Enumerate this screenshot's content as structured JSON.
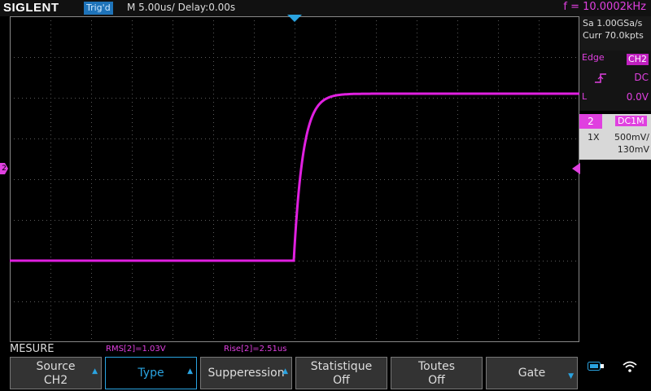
{
  "header": {
    "brand": "SIGLENT",
    "trigger_status": "Trig'd",
    "timebase": "M 5.00us/",
    "delay": "Delay:0.00s",
    "frequency": "f = 10.0002kHz"
  },
  "acquisition": {
    "sample_rate": "Sa 1.00GSa/s",
    "memory": "Curr 70.0kpts"
  },
  "trigger": {
    "type_label": "Edge",
    "source": "CH2",
    "coupling": "DC",
    "level_label": "L",
    "level_value": "0.0V",
    "slope_icon": "rising-edge-icon"
  },
  "channel": {
    "number": "2",
    "coupling": "DC1M",
    "probe": "1X",
    "scale": "500mV/",
    "offset": "130mV"
  },
  "markers": {
    "channel_marker": "2"
  },
  "measure": {
    "menu_title": "MESURE",
    "items": [
      {
        "label": "RMS[2]=1.03V"
      },
      {
        "label": "Rise[2]=2.51us"
      }
    ]
  },
  "softkeys": [
    {
      "line1": "Source",
      "line2": "CH2",
      "arrow": "up",
      "active": false
    },
    {
      "line1": "Type",
      "line2": "",
      "arrow": "up",
      "active": true
    },
    {
      "line1": "Supperession",
      "line2": "",
      "arrow": "up",
      "active": false
    },
    {
      "line1": "Statistique",
      "line2": "Off",
      "arrow": "",
      "active": false
    },
    {
      "line1": "Toutes",
      "line2": "Off",
      "arrow": "",
      "active": false
    },
    {
      "line1": "Gate",
      "line2": "",
      "arrow": "down",
      "active": false
    }
  ],
  "waveform": {
    "color": "#e020e0",
    "low_level_div": -2.0,
    "high_level_div": 2.1,
    "edge_time_div": -0.02,
    "rise_time_div": 0.5
  },
  "colors": {
    "channel2": "#e040e0",
    "accent": "#2aa3e0",
    "grid": "#5a5a5a"
  }
}
